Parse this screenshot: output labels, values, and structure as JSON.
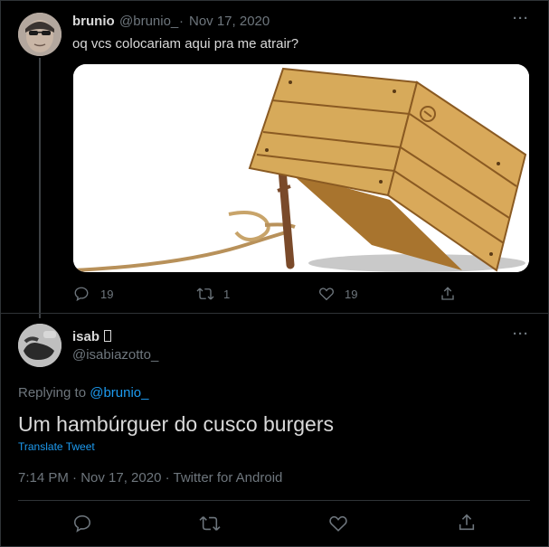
{
  "colors": {
    "background": "#000000",
    "text": "#d9d9d9",
    "muted": "#6e767d",
    "link": "#1d9bf0",
    "border": "#2f3336"
  },
  "original_tweet": {
    "display_name": "brunio",
    "handle": "@brunio_",
    "separator": "·",
    "date": "Nov 17, 2020",
    "text": "oq vcs colocariam aqui pra me atrair?",
    "media_icon": "box-trap-image",
    "actions": {
      "reply_count": "19",
      "retweet_count": "1",
      "like_count": "19"
    },
    "more_icon": "more-icon"
  },
  "reply_tweet": {
    "display_name": "isab ",
    "handle": "@isabiazotto_",
    "replying_to_prefix": "Replying to ",
    "replying_to_handle": "@brunio_",
    "text": "Um hambúrguer do cusco burgers",
    "translate_label": "Translate Tweet",
    "timestamp": "7:14 PM · Nov 17, 2020 · Twitter for Android"
  }
}
